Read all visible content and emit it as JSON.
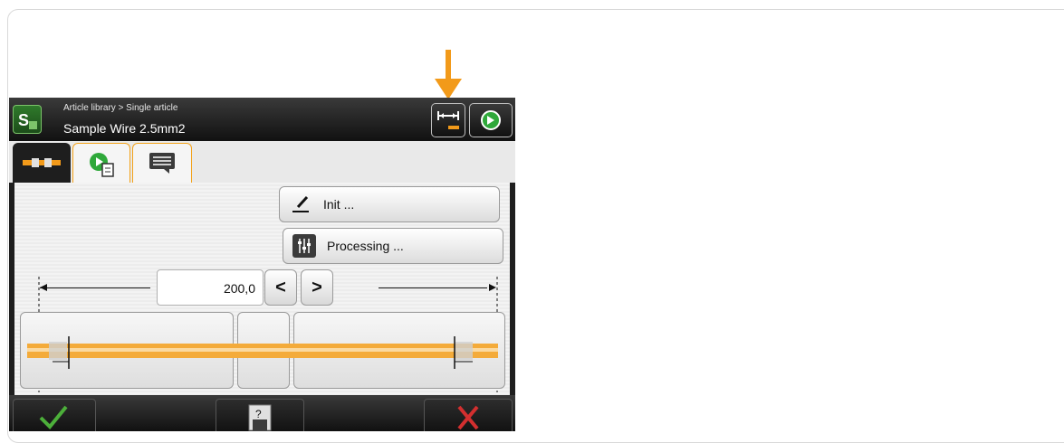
{
  "header": {
    "breadcrumb": "Article library > Single article",
    "title": "Sample Wire 2.5mm2"
  },
  "tabs": [
    {
      "name": "wire-tab",
      "icon": "wire-icon",
      "active": true
    },
    {
      "name": "process-tab",
      "icon": "process-icon",
      "active": false
    },
    {
      "name": "comment-tab",
      "icon": "comment-icon",
      "active": false
    }
  ],
  "buttons": {
    "init_label": "Init ...",
    "processing_label": "Processing ..."
  },
  "length": {
    "value": "200,0",
    "decrease": "<",
    "increase": ">"
  },
  "colors": {
    "accent": "#f29a1a",
    "confirm": "#4caf3a",
    "cancel": "#d32f2f"
  }
}
